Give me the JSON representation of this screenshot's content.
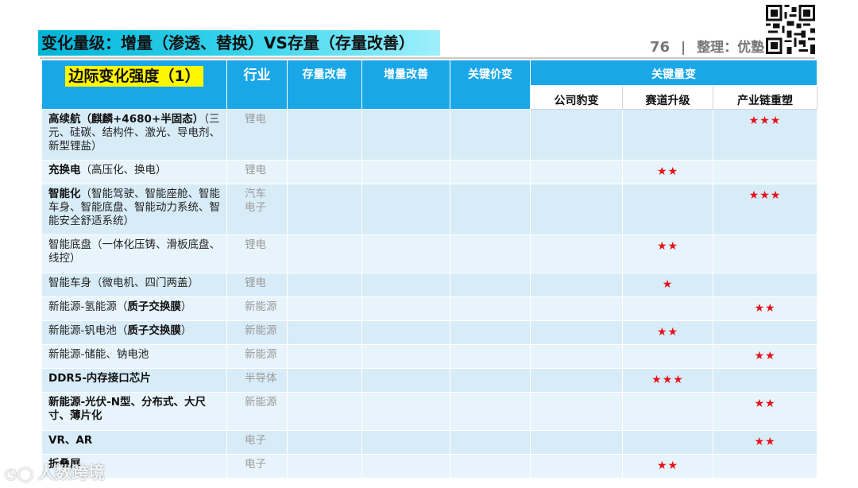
{
  "title": "变化量级：增量（渗透、替换）VS存量（存量改善）",
  "page": {
    "number": "76",
    "separator": "|",
    "credit": "整理：优塾"
  },
  "table": {
    "corner_label": "边际变化强度（1）",
    "headers": {
      "industry": "行业",
      "stock_improve": "存量改善",
      "increment_improve": "增量改善",
      "key_price": "关键价变",
      "key_volume": "关键量变",
      "company_leopard": "公司豹变",
      "track_upgrade": "赛道升级",
      "chain_reshape": "产业链重塑"
    },
    "rows": [
      {
        "bold": "高续航（麒麟+4680+半固态）",
        "rest": "（三元、硅碳、结构件、激光、导电剂、新型锂盐）",
        "industry": "锂电",
        "leopard": "",
        "track": "",
        "chain": "★★★"
      },
      {
        "bold": "充换电",
        "rest": "（高压化、换电）",
        "industry": "锂电",
        "leopard": "",
        "track": "★★",
        "chain": ""
      },
      {
        "bold": "智能化",
        "rest": "（智能驾驶、智能座舱、智能车身、智能底盘、智能动力系统、智能安全舒适系统）",
        "industry": "汽车电子",
        "leopard": "",
        "track": "",
        "chain": "★★★"
      },
      {
        "bold": "",
        "rest": "智能底盘（一体化压铸、滑板底盘、线控）",
        "industry": "锂电",
        "leopard": "",
        "track": "★★",
        "chain": ""
      },
      {
        "bold": "",
        "rest": "智能车身（微电机、四门两盖）",
        "industry": "锂电",
        "leopard": "",
        "track": "★",
        "chain": ""
      },
      {
        "bold": "",
        "rest": "新能源-氢能源（",
        "bold2": "质子交换膜",
        "rest2": "）",
        "industry": "新能源",
        "leopard": "",
        "track": "",
        "chain": "★★"
      },
      {
        "bold": "",
        "rest": "新能源-钒电池（",
        "bold2": "质子交换膜",
        "rest2": "）",
        "industry": "新能源",
        "leopard": "",
        "track": "★★",
        "chain": ""
      },
      {
        "bold": "",
        "rest": "新能源-储能、钠电池",
        "industry": "新能源",
        "leopard": "",
        "track": "",
        "chain": "★★"
      },
      {
        "bold": "DDR5-内存接口芯片",
        "rest": "",
        "industry": "半导体",
        "leopard": "",
        "track": "★★★",
        "chain": ""
      },
      {
        "bold": "新能源-光伏-N型、分布式、大尺寸、薄片化",
        "rest": "",
        "industry": "新能源",
        "leopard": "",
        "track": "",
        "chain": "★★"
      },
      {
        "bold": "VR、AR",
        "rest": "",
        "industry": "电子",
        "leopard": "",
        "track": "",
        "chain": "★★"
      },
      {
        "bold": "折叠屏",
        "rest": "",
        "industry": "电子",
        "leopard": "",
        "track": "★★",
        "chain": ""
      }
    ]
  },
  "watermark": {
    "text": "人数跨境"
  },
  "colors": {
    "header": "#1aa7e8",
    "stars": "#e8101a",
    "title_bar": "#00b4d8",
    "highlight": "#fff700"
  }
}
